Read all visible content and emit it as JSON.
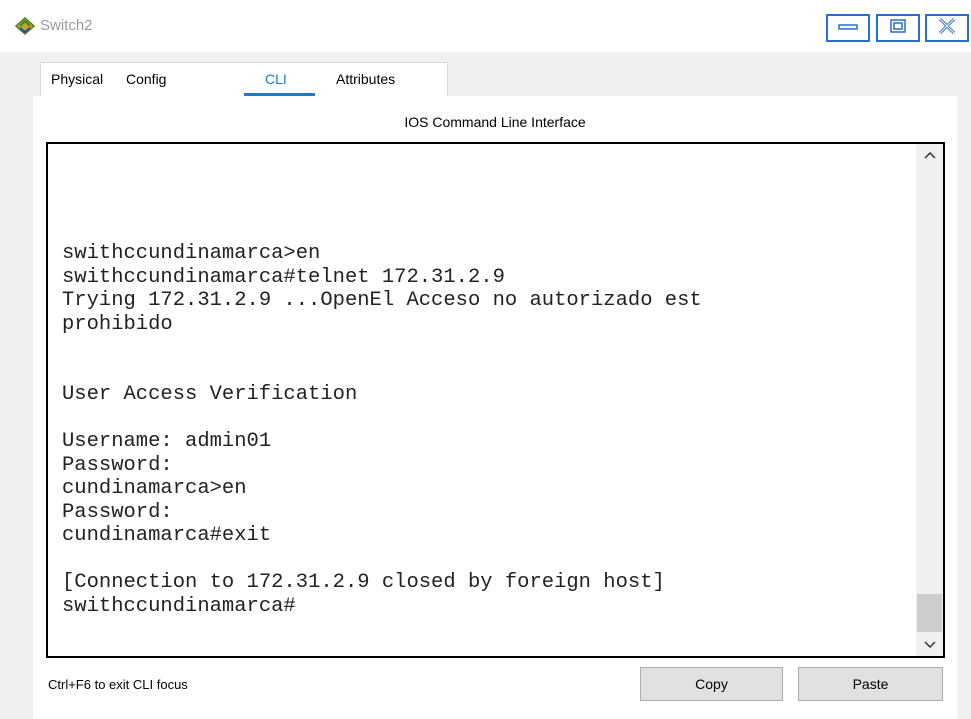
{
  "window": {
    "title": "Switch2"
  },
  "tabs": [
    {
      "label": "Physical"
    },
    {
      "label": "Config"
    },
    {
      "label": "CLI"
    },
    {
      "label": "Attributes"
    }
  ],
  "active_tab": "CLI",
  "panel": {
    "title": "IOS Command Line Interface"
  },
  "terminal": {
    "lines": [
      "swithccundinamarca>en",
      "swithccundinamarca#telnet 172.31.2.9",
      "Trying 172.31.2.9 ...OpenEl Acceso no autorizado est",
      "prohibido",
      "",
      "",
      "User Access Verification",
      "",
      "Username: admin01",
      "Password:",
      "cundinamarca>en",
      "Password:",
      "cundinamarca#exit",
      "",
      "[Connection to 172.31.2.9 closed by foreign host]",
      "swithccundinamarca#"
    ]
  },
  "footer": {
    "hint": "Ctrl+F6 to exit CLI focus",
    "copy_label": "Copy",
    "paste_label": "Paste"
  },
  "colors": {
    "accent": "#1e78d2",
    "window_button_border": "#2a6fc9"
  }
}
